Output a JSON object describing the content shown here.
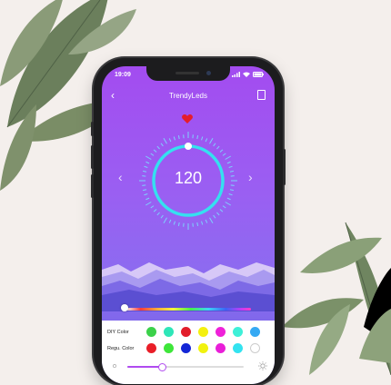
{
  "status_bar": {
    "time": "19:09"
  },
  "header": {
    "title": "TrendyLeds",
    "back_icon": "chevron-left-icon",
    "menu_icon": "document-icon"
  },
  "dial": {
    "value": "120",
    "left_icon": "chevron-left-icon",
    "right_icon": "chevron-right-icon"
  },
  "colors": {
    "accent": "#a34cf0",
    "diy_label": "DIY Color",
    "regular_label": "Regu. Color",
    "diy": [
      "#3bd14a",
      "#2ee6b8",
      "#e21d2a",
      "#f4f00f",
      "#ef21d9",
      "#3ef0d8",
      "#35a9f3"
    ],
    "regular": [
      "#e91e28",
      "#3ee63a",
      "#1426d6",
      "#f1f20f",
      "#e91ed8",
      "#33e3f0",
      "#ffffff"
    ]
  },
  "brightness": {
    "level": 0.3
  }
}
